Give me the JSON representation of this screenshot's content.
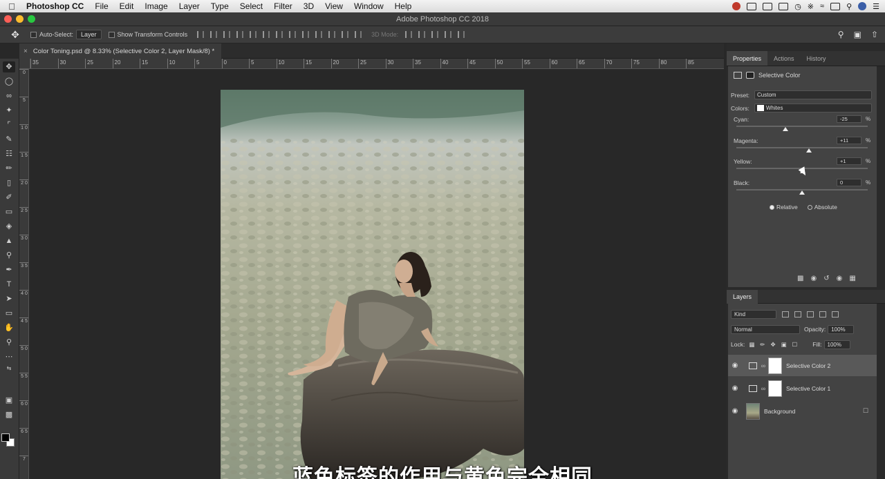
{
  "menubar": {
    "app_name": "Photoshop CC",
    "items": [
      "File",
      "Edit",
      "Image",
      "Layer",
      "Type",
      "Select",
      "Filter",
      "3D",
      "View",
      "Window",
      "Help"
    ]
  },
  "window": {
    "title": "Adobe Photoshop CC 2018"
  },
  "options_bar": {
    "auto_select_label": "Auto-Select:",
    "auto_select_value": "Layer",
    "show_transform_label": "Show Transform Controls",
    "mode_3d_label": "3D Mode:"
  },
  "document_tab": {
    "label": "Color Toning.psd @ 8.33% (Selective Color 2, Layer Mask/8) *"
  },
  "rulers": {
    "horizontal": [
      "35",
      "30",
      "25",
      "20",
      "15",
      "10",
      "5",
      "0",
      "5",
      "10",
      "15",
      "20",
      "25",
      "30",
      "35",
      "40",
      "45",
      "50",
      "55",
      "60",
      "65",
      "70",
      "75",
      "80",
      "85"
    ],
    "vertical": [
      "0",
      "5",
      "1 0",
      "1 5",
      "2 0",
      "2 5",
      "3 0",
      "3 5",
      "4 0",
      "4 5",
      "5 0",
      "5 5",
      "6 0",
      "6 5",
      "7"
    ]
  },
  "properties_panel": {
    "tabs": [
      "Properties",
      "Actions",
      "History"
    ],
    "title": "Selective Color",
    "preset_label": "Preset:",
    "preset_value": "Custom",
    "colors_label": "Colors:",
    "colors_value": "Whites",
    "sliders": [
      {
        "label": "Cyan:",
        "value": "-25",
        "unit": "%",
        "fraction": 0.375
      },
      {
        "label": "Magenta:",
        "value": "+11",
        "unit": "%",
        "fraction": 0.555
      },
      {
        "label": "Yellow:",
        "value": "+1",
        "unit": "%",
        "fraction": 0.505
      },
      {
        "label": "Black:",
        "value": "0",
        "unit": "%",
        "fraction": 0.5
      }
    ],
    "method_relative": "Relative",
    "method_absolute": "Absolute"
  },
  "layers_panel": {
    "tab": "Layers",
    "filter_kind": "Kind",
    "blend_mode": "Normal",
    "opacity_label": "Opacity:",
    "opacity_value": "100%",
    "lock_label": "Lock:",
    "fill_label": "Fill:",
    "fill_value": "100%",
    "layers": [
      {
        "name": "Selective Color 2",
        "selected": true
      },
      {
        "name": "Selective Color 1",
        "selected": false
      },
      {
        "name": "Background",
        "selected": false
      }
    ]
  },
  "subtitle": "蓝色标签的作用与黄色完全相同"
}
